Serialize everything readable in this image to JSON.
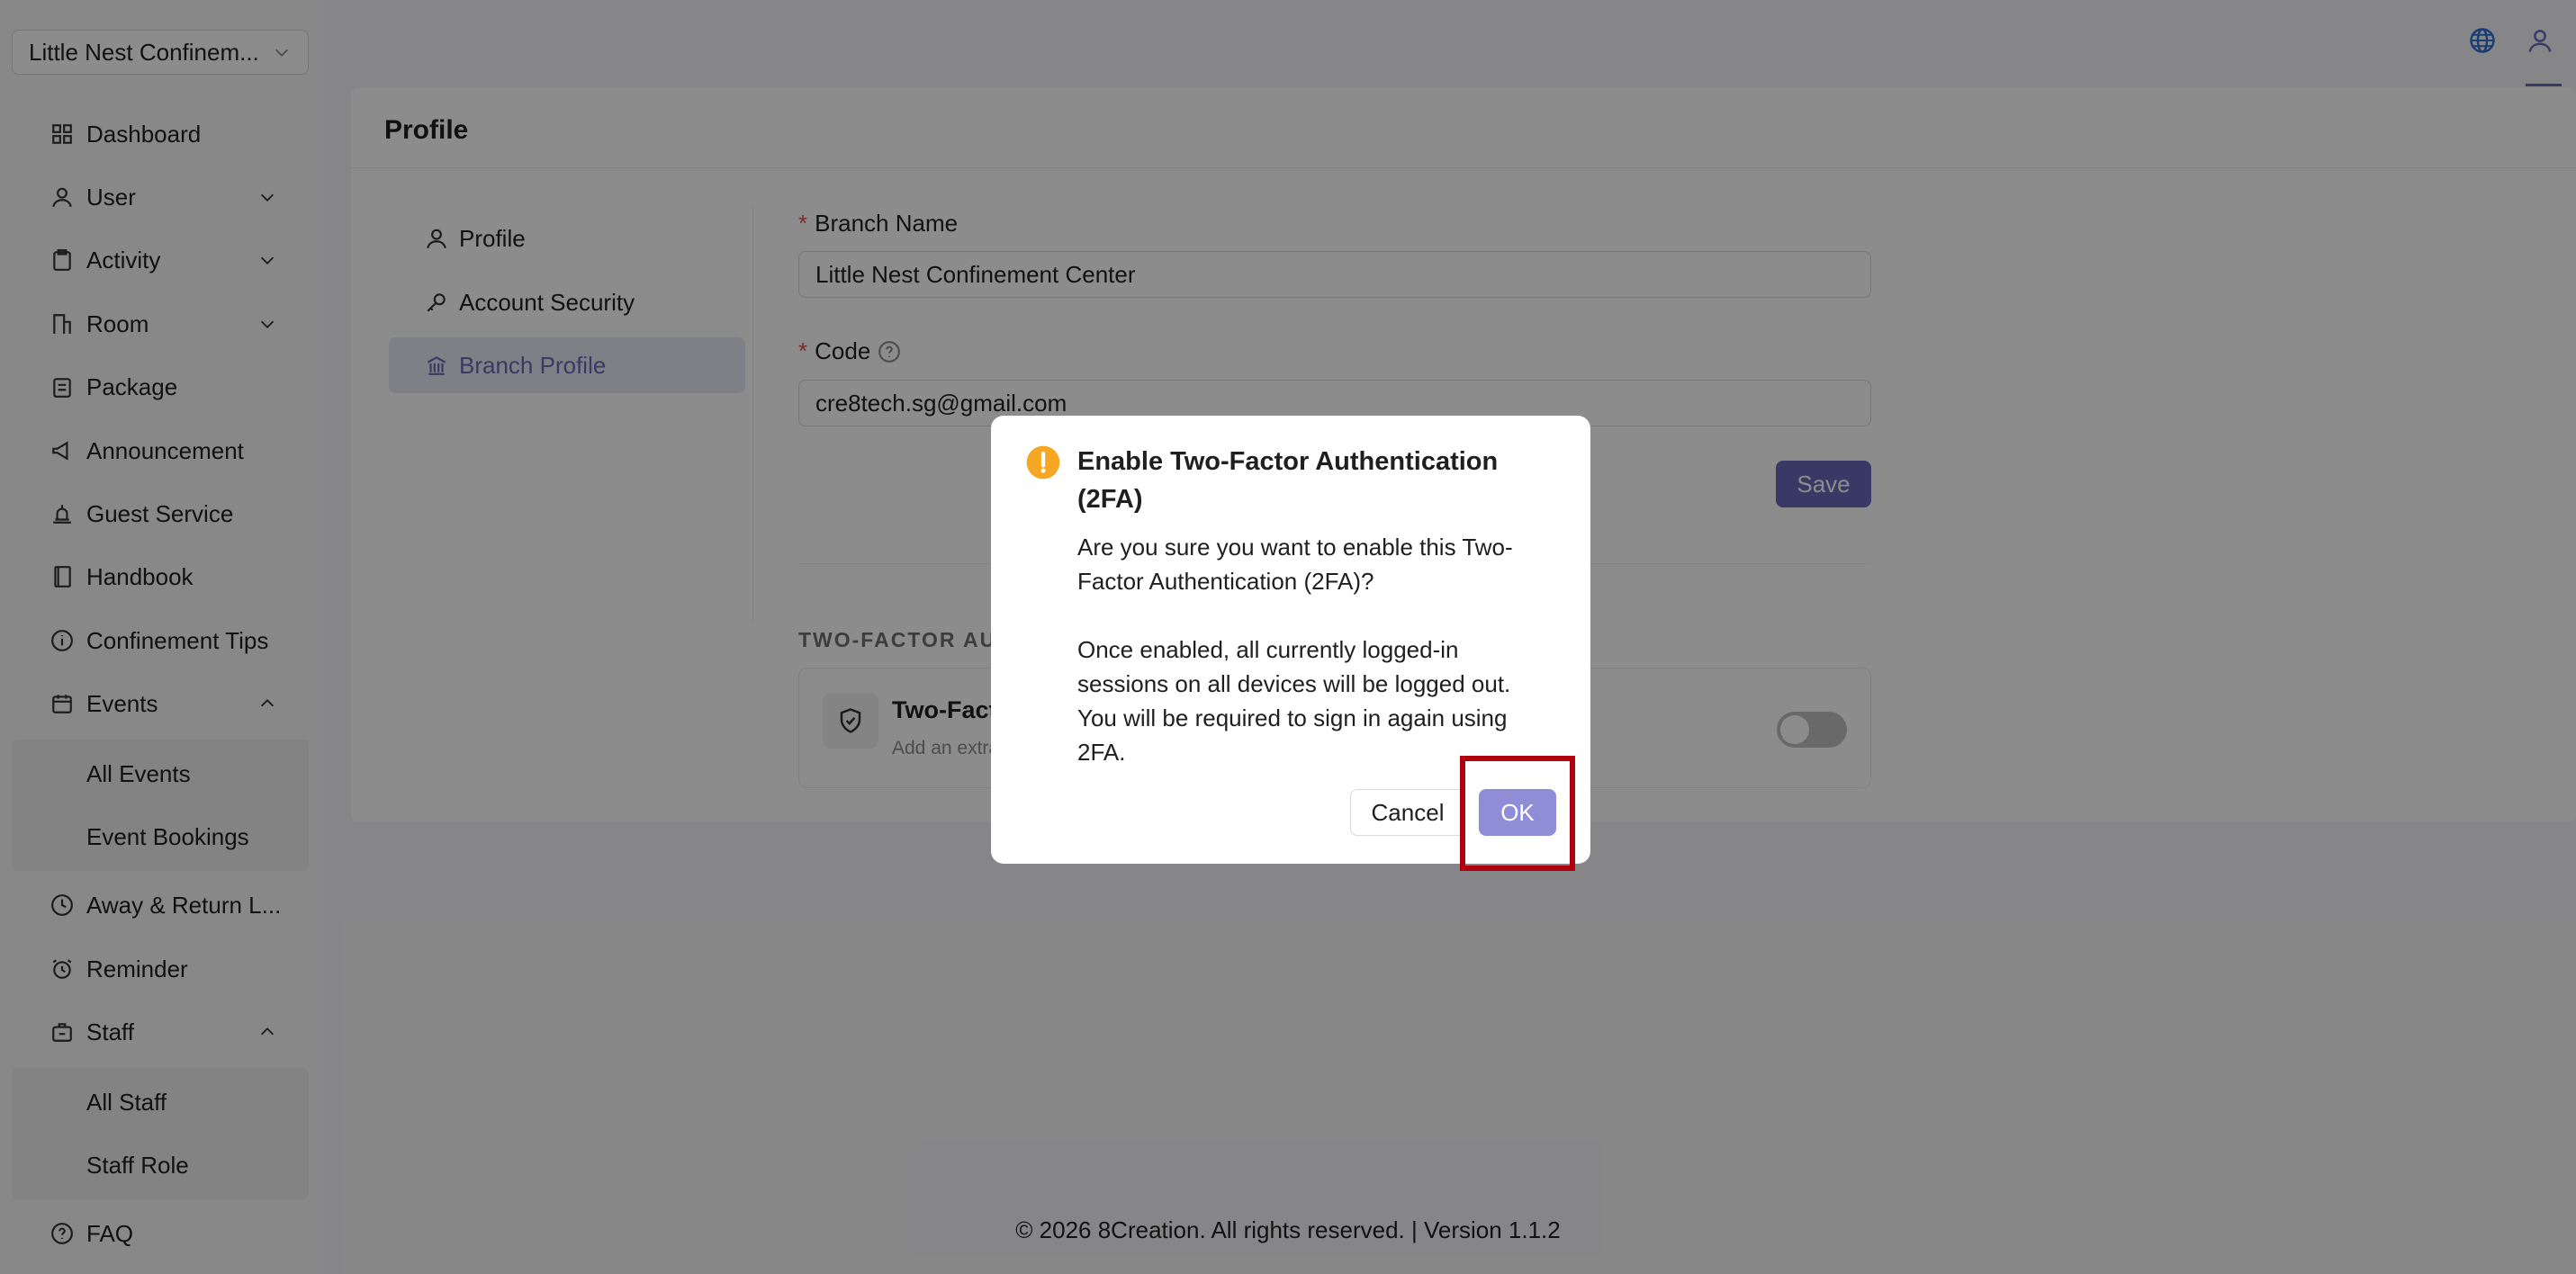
{
  "branch_selector": {
    "value": "Little Nest Confinem..."
  },
  "sidebar": {
    "items": [
      {
        "label": "Dashboard",
        "icon": "dashboard-icon"
      },
      {
        "label": "User",
        "icon": "user-icon",
        "expand": "down"
      },
      {
        "label": "Activity",
        "icon": "clipboard-icon",
        "expand": "down"
      },
      {
        "label": "Room",
        "icon": "room-icon",
        "expand": "down"
      },
      {
        "label": "Package",
        "icon": "package-icon"
      },
      {
        "label": "Announcement",
        "icon": "megaphone-icon"
      },
      {
        "label": "Guest Service",
        "icon": "bell-icon"
      },
      {
        "label": "Handbook",
        "icon": "book-icon"
      },
      {
        "label": "Confinement Tips",
        "icon": "info-icon"
      },
      {
        "label": "Events",
        "icon": "calendar-icon",
        "expand": "up"
      },
      {
        "label": "Away & Return L...",
        "icon": "clock-icon"
      },
      {
        "label": "Reminder",
        "icon": "alarm-icon"
      },
      {
        "label": "Staff",
        "icon": "staff-icon",
        "expand": "up"
      },
      {
        "label": "FAQ",
        "icon": "question-icon"
      }
    ],
    "events_sub": [
      "All Events",
      "Event Bookings"
    ],
    "staff_sub": [
      "All Staff",
      "Staff Role"
    ]
  },
  "page": {
    "title": "Profile",
    "tabs": [
      {
        "label": "Profile",
        "icon": "user-icon"
      },
      {
        "label": "Account Security",
        "icon": "key-icon"
      },
      {
        "label": "Branch Profile",
        "icon": "bank-icon",
        "active": true
      }
    ],
    "form": {
      "branch_name_label": "Branch Name",
      "branch_name_value": "Little Nest Confinement Center",
      "code_label": "Code",
      "code_value": "cre8tech.sg@gmail.com",
      "save_label": "Save"
    },
    "twofa": {
      "section_title": "TWO-FACTOR AUT",
      "title": "Two-Fact",
      "desc": "Add an extra",
      "enabled": false
    }
  },
  "footer": {
    "text": "© 2026 8Creation. All rights reserved. | Version 1.1.2"
  },
  "modal": {
    "title": "Enable Two-Factor Authentication (2FA)",
    "body": "Are you sure you want to enable this Two-Factor Authentication (2FA)?\n\nOnce enabled, all currently logged-in sessions on all devices will be logged out. You will be required to sign in again using 2FA.",
    "cancel_label": "Cancel",
    "ok_label": "OK"
  },
  "colors": {
    "accent": "#6b69b8",
    "ok_button": "#8f8dd6",
    "highlight": "#b0000f",
    "warning": "#f5a623"
  }
}
